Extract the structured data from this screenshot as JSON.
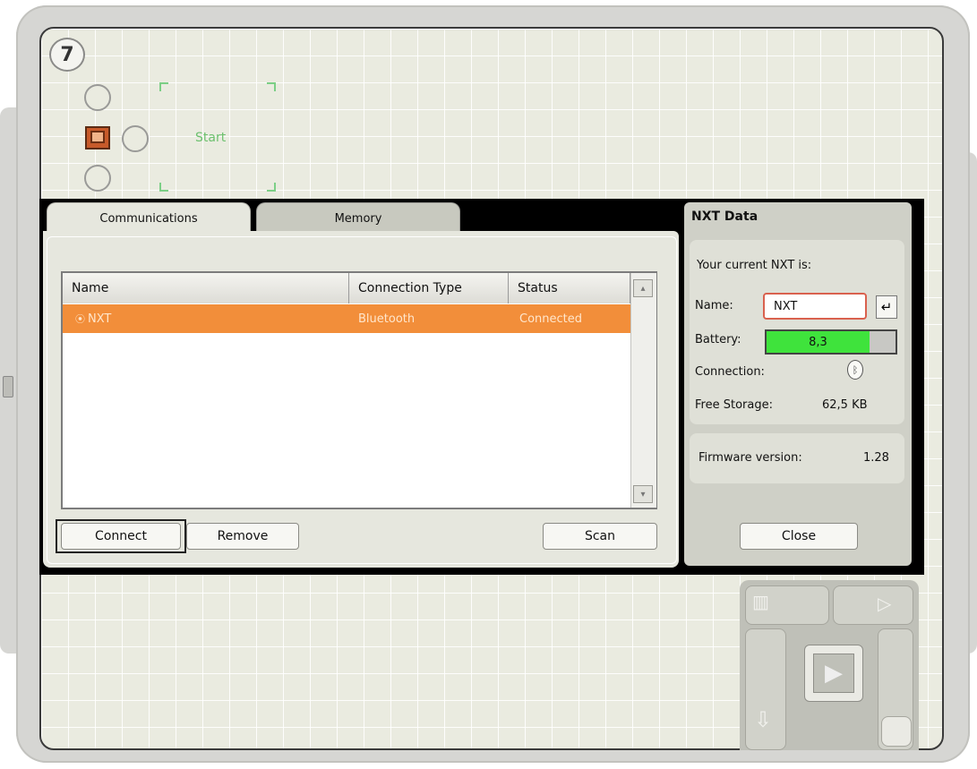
{
  "step_number": "7",
  "sequence": {
    "start_label": "Start"
  },
  "tabs": [
    {
      "label": "Communications",
      "active": true
    },
    {
      "label": "Memory",
      "active": false
    }
  ],
  "device_list": {
    "columns": [
      "Name",
      "Connection Type",
      "Status"
    ],
    "rows": [
      {
        "name": "NXT",
        "connection_type": "Bluetooth",
        "status": "Connected",
        "selected": true
      }
    ]
  },
  "buttons": {
    "connect": "Connect",
    "remove": "Remove",
    "scan": "Scan",
    "close": "Close"
  },
  "nxt_data": {
    "title": "NXT Data",
    "current_label": "Your current NXT is:",
    "name_label": "Name:",
    "name_value": "NXT",
    "battery_label": "Battery:",
    "battery_value": "8,3",
    "battery_level": 0.8,
    "connection_label": "Connection:",
    "connection_icon": "bluetooth-icon",
    "free_storage_label": "Free Storage:",
    "free_storage_value": "62,5 KB",
    "firmware_label": "Firmware version:",
    "firmware_value": "1.28"
  },
  "colors": {
    "selection": "#f28e3a",
    "battery": "#3fe33c",
    "name_field_border": "#d9614e"
  }
}
